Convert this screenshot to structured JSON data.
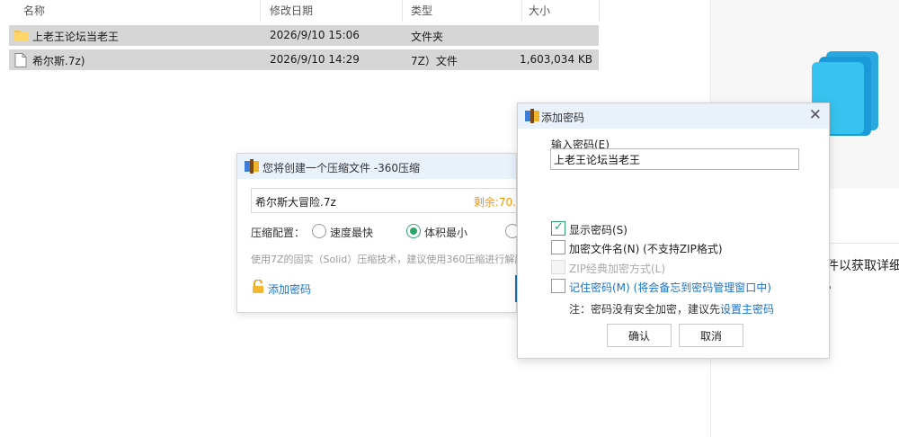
{
  "filelist": {
    "headers": {
      "name": "名称",
      "modified": "修改日期",
      "type": "类型",
      "size": "大小"
    },
    "rows": [
      {
        "name": "上老王论坛当老王",
        "modified": "2026/9/10 15:06",
        "type": "文件夹",
        "size": "",
        "icon": "folder-icon"
      },
      {
        "name": "希尔斯.7z)",
        "modified": "2026/9/10 14:29",
        "type": "7Z）文件",
        "size": "1,603,034 KB",
        "icon": "file-icon"
      }
    ]
  },
  "right_panel": {
    "text": "件以获取详细",
    "dot": "。"
  },
  "compress_dialog": {
    "title": "您将创建一个压缩文件 -360压缩",
    "filename": "希尔斯大冒险.7z",
    "remaining": "剩余:70.",
    "config_label": "压缩配置：",
    "options": [
      "速度最快",
      "体积最小"
    ],
    "hint": "使用7Z的固实（Solid）压缩技术，建议使用360压缩进行解压",
    "add_password": "添加密码"
  },
  "password_dialog": {
    "title": "添加密码",
    "input_label": "输入密码(E)",
    "input_value": "上老王论坛当老王",
    "show_password": "显示密码(S)",
    "encrypt_filenames": "加密文件名(N) (不支持ZIP格式)",
    "zip_classic": "ZIP经典加密方式(L)",
    "remember": "记住密码(M) (将会备忘到密码管理窗口中)",
    "note_prefix": "注：密码没有安全加密，建议先",
    "note_link": "设置主密码",
    "ok": "确认",
    "cancel": "取消"
  },
  "colors": {
    "accent": "#1a73c7",
    "check_green": "#2fa36b",
    "remaining_orange": "#f39800"
  }
}
